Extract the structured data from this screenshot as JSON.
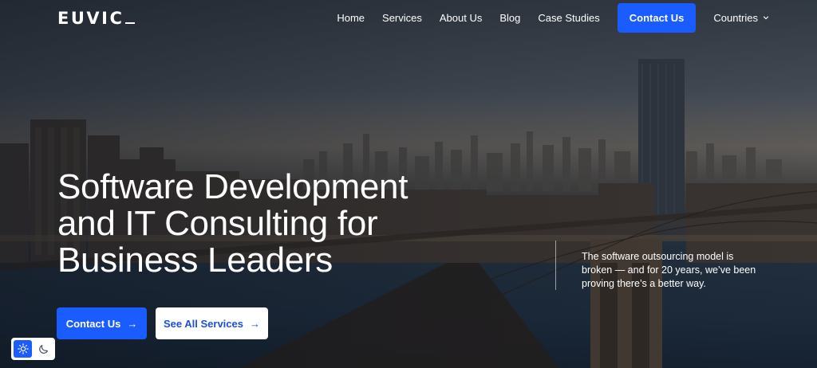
{
  "brand": {
    "logo_text": "EUVIC"
  },
  "nav": {
    "links": [
      "Home",
      "Services",
      "About Us",
      "Blog",
      "Case Studies"
    ],
    "cta_label": "Contact Us",
    "countries_label": "Countries"
  },
  "hero": {
    "title_lines": [
      "Software Development",
      "and IT Consulting for",
      "Business Leaders"
    ],
    "description": "The software outsourcing model is broken — and for 20 years, we’ve been proving there’s a better way.",
    "primary_button": "Contact Us",
    "secondary_button": "See All Services"
  },
  "theme_toggle": {
    "options": [
      "light",
      "dark"
    ],
    "active": "light"
  },
  "colors": {
    "accent": "#1a5cff",
    "text_on_dark": "#ffffff",
    "secondary_button_text": "#1a4fd8"
  }
}
